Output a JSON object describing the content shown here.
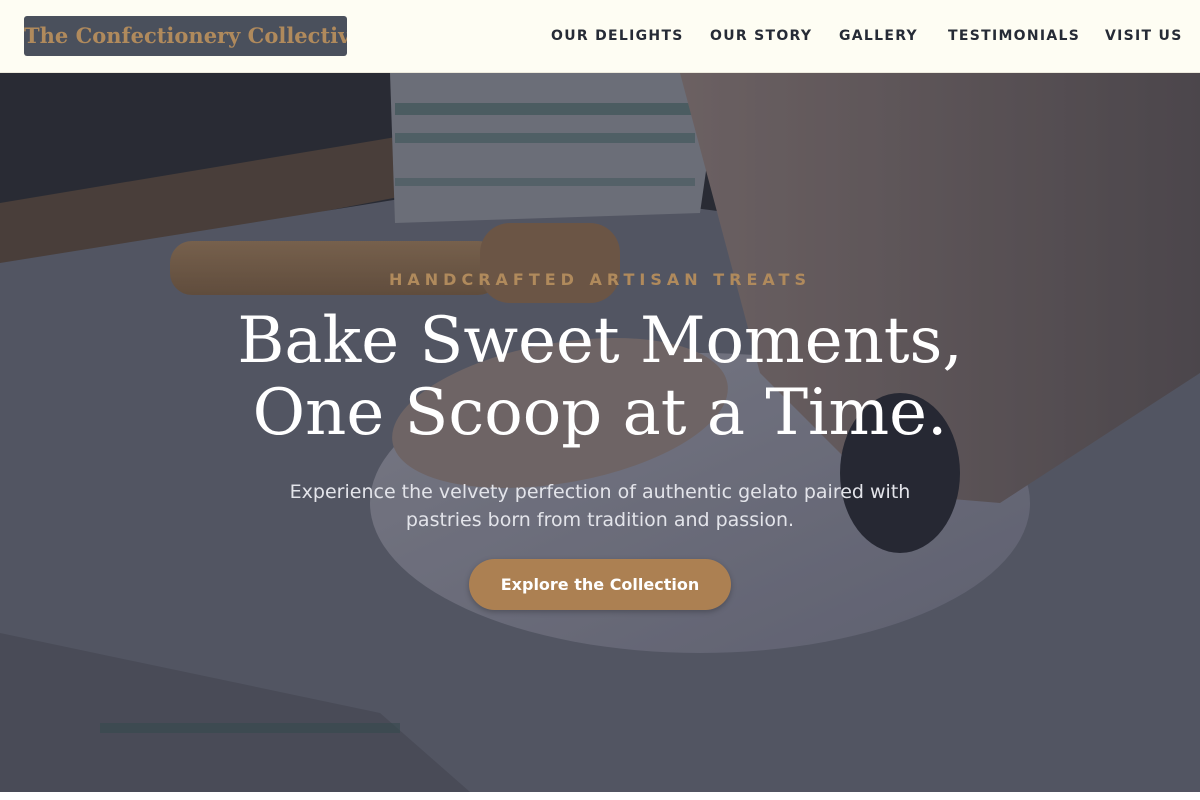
{
  "header": {
    "logo_text": "The Confectionery Collective",
    "nav": [
      {
        "label": "OUR DELIGHTS"
      },
      {
        "label": "OUR STORY"
      },
      {
        "label": "GALLERY"
      },
      {
        "label": "TESTIMONIALS"
      },
      {
        "label": "VISIT US"
      }
    ]
  },
  "hero": {
    "eyebrow": "HANDCRAFTED ARTISAN TREATS",
    "headline_line1": "Bake Sweet Moments,",
    "headline_line2": "One Scoop at a Time.",
    "subtitle": "Experience the velvety perfection of authentic gelato paired with pastries born from tradition and passion.",
    "cta_label": "Explore the Collection"
  },
  "colors": {
    "header_bg": "#fefdf3",
    "logo_bg": "#4a505c",
    "accent": "#b08a5c",
    "button": "#ac8052",
    "nav_text": "#262b36"
  }
}
